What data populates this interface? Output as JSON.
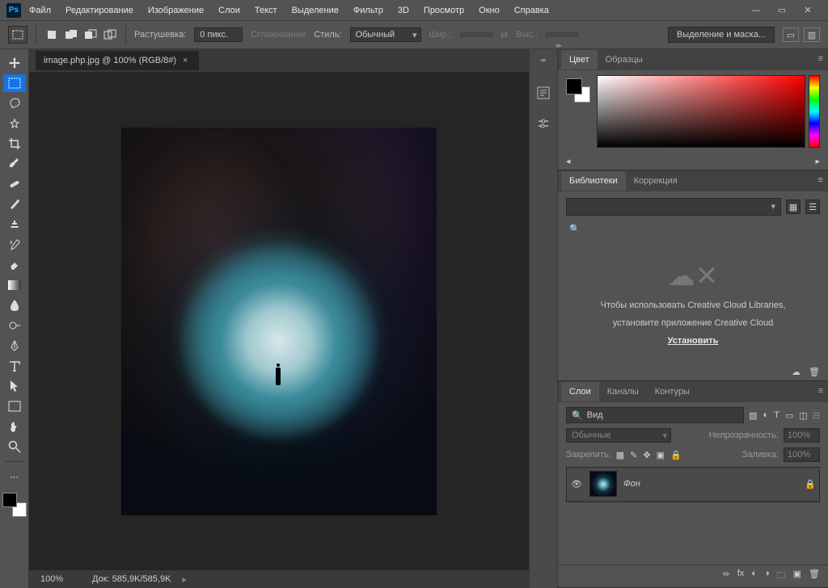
{
  "menu": [
    "Файл",
    "Редактирование",
    "Изображение",
    "Слои",
    "Текст",
    "Выделение",
    "Фильтр",
    "3D",
    "Просмотр",
    "Окно",
    "Справка"
  ],
  "optionsbar": {
    "feather_label": "Растушевка:",
    "feather_value": "0 пикс.",
    "antialias": "Сглаживание",
    "style_label": "Стиль:",
    "style_value": "Обычный",
    "width_label": "Шир.:",
    "height_label": "Выс.:",
    "select_mask": "Выделение и маска..."
  },
  "tab": {
    "title": "image.php.jpg @ 100% (RGB/8#)"
  },
  "status": {
    "zoom": "100%",
    "doc": "Док: 585,9K/585,9K"
  },
  "panels": {
    "color": {
      "tab1": "Цвет",
      "tab2": "Образцы"
    },
    "libraries": {
      "tab1": "Библиотеки",
      "tab2": "Коррекция",
      "msg1": "Чтобы использовать Creative Cloud Libraries,",
      "msg2": "установите приложение Creative Cloud",
      "install": "Установить"
    },
    "layers": {
      "tab1": "Слои",
      "tab2": "Каналы",
      "tab3": "Контуры",
      "kind": "Вид",
      "mode": "Обычные",
      "opacity_label": "Непрозрачность:",
      "opacity_value": "100%",
      "lock_label": "Закрепить:",
      "fill_label": "Заливка:",
      "fill_value": "100%",
      "layer0_name": "Фон"
    }
  }
}
